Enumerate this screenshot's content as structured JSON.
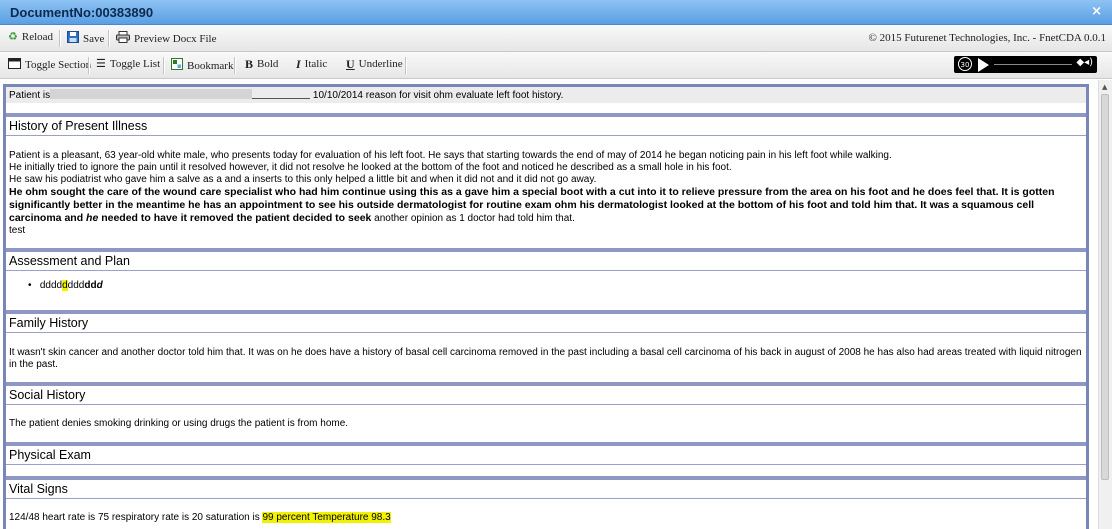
{
  "window": {
    "title": "DocumentNo:00383890",
    "close_icon": "close-icon",
    "close_label": "×"
  },
  "toolbar1": {
    "reload_label": "Reload",
    "save_label": "Save",
    "preview_label": "Preview Docx File",
    "copyright": "© 2015 Futurenet Technologies, Inc. - FnetCDA 0.0.1"
  },
  "toolbar2": {
    "toggle_section_label": "Toggle Section",
    "toggle_list_label": "Toggle List",
    "bookmark_label": "Bookmark",
    "bold_label": "Bold",
    "italic_label": "Italic",
    "underline_label": "Underline"
  },
  "player": {
    "rewind_label": "30"
  },
  "document": {
    "intro": {
      "prefix": "Patient is",
      "date_text": "10/10/2014 reason for visit ohm evaluate left foot history."
    },
    "hpi": {
      "heading": "History of Present Illness",
      "line1": "Patient is a pleasant, 63 year-old white male, who presents today for evaluation of his left foot.  He says that starting towards the end of may of 2014 he began noticing pain in his left foot while walking.",
      "line2": "He initially tried to ignore the pain until it resolved however, it did not resolve he looked at the bottom of the foot and noticed he described as a small hole in his foot.",
      "line3": "He saw his podiatrist who gave him a salve as a and a inserts to this only helped a little bit and when it did not and it did not go away.",
      "bold_text": "He ohm sought the care of the wound care specialist who had him continue using this as a gave him a special boot with a cut into it to relieve pressure from the area on his foot and he does feel that.  It is gotten significantly better in the meantime he has an appointment to see his outside dermatologist for routine exam ohm his dermatologist looked at the bottom of his foot and told him that.  It was a squamous cell carcinoma and ",
      "bold_italic": "he",
      "bold_text2": " needed to have it removed the patient decided to seek",
      "normal_tail": " another opinion as 1 doctor had told him that.",
      "test_line": "test"
    },
    "assessment": {
      "heading": "Assessment and Plan",
      "item_a": "dddd",
      "item_hl": "d",
      "item_b": "ddd",
      "item_bold": "dd",
      "item_bi": "d"
    },
    "family": {
      "heading": "Family History",
      "text": "It wasn't skin cancer and another doctor told him that.  It was on he does have a history of basal cell carcinoma removed in the past including a basal cell carcinoma of his back in august of 2008 he has also had areas treated with liquid nitrogen in the past."
    },
    "social": {
      "heading": "Social History",
      "text": "The patient denies smoking drinking or using drugs the patient is from home."
    },
    "physical": {
      "heading": "Physical Exam"
    },
    "vitals": {
      "heading": "Vital Signs",
      "text": "124/48 heart rate is 75 respiratory rate is 20 saturation is ",
      "highlighted": "99 percent Temperature 98.3"
    }
  }
}
